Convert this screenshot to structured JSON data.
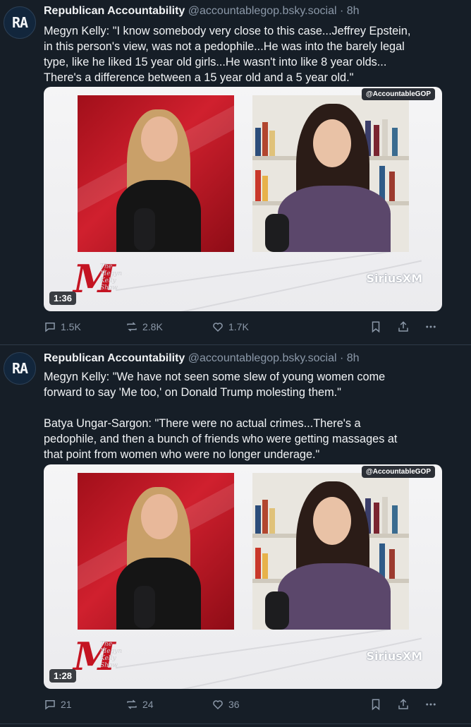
{
  "posts": [
    {
      "avatar_text": "RA",
      "author": "Republican Accountability",
      "handle": "@accountablegop.bsky.social",
      "time": "· 8h",
      "text": "Megyn Kelly: \"I know somebody very close to this case...Jeffrey Epstein,\nin this person's view, was not a pedophile...He was into the barely legal\ntype, like he liked 15 year old girls...He wasn't into like 8 year olds...\nThere's a difference between a 15 year old and a 5 year old.\"",
      "video": {
        "watermark": "@AccountableGOP",
        "logo_letter": "M",
        "logo_text": "The\nMegyn\nKelly\nShow",
        "brand": "SiriusXM",
        "duration": "1:36"
      },
      "replies": "1.5K",
      "reposts": "2.8K",
      "likes": "1.7K"
    },
    {
      "avatar_text": "RA",
      "author": "Republican Accountability",
      "handle": "@accountablegop.bsky.social",
      "time": "· 8h",
      "text": "Megyn Kelly: \"We have not seen some slew of young women come\nforward to say 'Me too,' on Donald Trump molesting them.\"\n\nBatya Ungar-Sargon: \"There were no actual crimes...There's a\npedophile, and then a bunch of friends who were getting massages at\nthat point from women who were no longer underage.\"",
      "video": {
        "watermark": "@AccountableGOP",
        "logo_letter": "M",
        "logo_text": "The\nMegyn\nKelly\nShow",
        "brand": "SiriusXM",
        "duration": "1:28"
      },
      "replies": "21",
      "reposts": "24",
      "likes": "36"
    }
  ],
  "icons": [
    "reply-icon",
    "repost-icon",
    "like-icon",
    "bookmark-icon",
    "share-icon",
    "more-icon"
  ],
  "colors": {
    "background": "#161e27",
    "text": "#f1f3f5",
    "muted": "#8b98a8",
    "divider": "#2e3a47",
    "red_set": "#c41422"
  }
}
